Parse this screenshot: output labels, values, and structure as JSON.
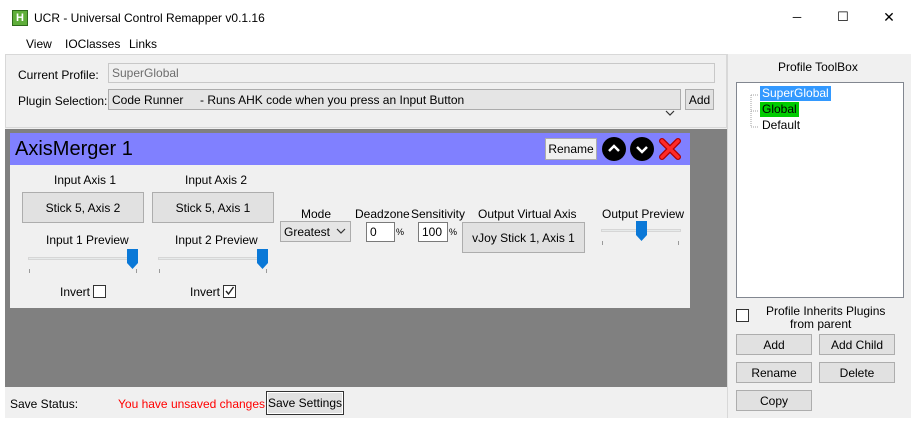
{
  "window": {
    "title": "UCR - Universal Control Remapper v0.1.16",
    "app_icon": "H",
    "controls": {
      "minimize": "─",
      "maximize": "☐",
      "close": "✕"
    }
  },
  "menu": [
    "View",
    "IOClasses",
    "Links"
  ],
  "header": {
    "current_profile_label": "Current Profile:",
    "current_profile_value": "SuperGlobal",
    "plugin_selection_label": "Plugin Selection:",
    "plugin_selection_value": "Code Runner     - Runs AHK code when you press an Input Button",
    "add_label": "Add"
  },
  "plugin": {
    "title": "AxisMerger 1",
    "rename_label": "Rename",
    "input_axis_1_label": "Input Axis 1",
    "input_axis_1_value": "Stick 5, Axis 2",
    "input_axis_2_label": "Input Axis 2",
    "input_axis_2_value": "Stick 5, Axis 1",
    "input_1_preview_label": "Input 1 Preview",
    "input_2_preview_label": "Input 2 Preview",
    "input_1_preview_level": 1.0,
    "input_2_preview_level": 1.0,
    "invert_label": "Invert",
    "invert_1_checked": false,
    "invert_2_checked": true,
    "mode_label": "Mode",
    "mode_value": "Greatest",
    "deadzone_label": "Deadzone",
    "deadzone_value": "0",
    "sensitivity_label": "Sensitivity",
    "sensitivity_value": "100",
    "percent": "%",
    "output_virtual_axis_label": "Output Virtual Axis",
    "output_virtual_axis_value": "vJoy Stick 1, Axis 1",
    "output_preview_label": "Output Preview",
    "output_preview_level": 0.5
  },
  "status": {
    "label": "Save Status:",
    "message": "You have unsaved changes",
    "save_label": "Save Settings"
  },
  "toolbox": {
    "title": "Profile ToolBox",
    "tree": [
      {
        "label": "SuperGlobal",
        "state": "selected"
      },
      {
        "label": "Global",
        "state": "active"
      },
      {
        "label": "Default",
        "state": "normal"
      }
    ],
    "inherits_label_line1": "Profile Inherits Plugins",
    "inherits_label_line2": "from parent",
    "add_label": "Add",
    "add_child_label": "Add Child",
    "rename_label": "Rename",
    "delete_label": "Delete",
    "copy_label": "Copy"
  },
  "colors": {
    "plugin_header": "#8080ff",
    "selected_bg": "#3399ff",
    "active_bg": "#00cc00",
    "status_text": "#ff0000",
    "panel_gray": "#808080",
    "form_bg": "#f0f0f0",
    "slider_thumb": "#0a78d7"
  }
}
